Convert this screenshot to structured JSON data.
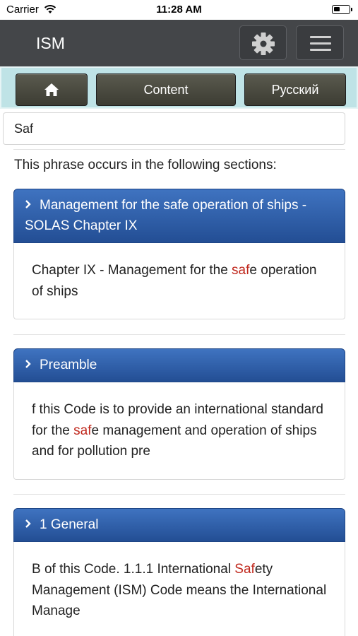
{
  "status_bar": {
    "carrier": "Carrier",
    "time": "11:28 AM",
    "battery_level": 0.4
  },
  "navbar": {
    "title": "ISM",
    "settings_icon": "gear-icon",
    "menu_icon": "hamburger-icon"
  },
  "toolbar": {
    "home_icon": "home-icon",
    "content_label": "Content",
    "language_label": "Русский"
  },
  "search": {
    "value": "Saf",
    "placeholder": ""
  },
  "results_intro": "This phrase occurs in the following sections:",
  "results": [
    {
      "title": "Management for the safe operation of ships - SOLAS Chapter IX",
      "excerpt_before": "Chapter IX - Management for the ",
      "excerpt_match": "saf",
      "excerpt_after": "e operation of ships"
    },
    {
      "title": "Preamble",
      "excerpt_before": "f this Code is to provide an international standard for the ",
      "excerpt_match": "saf",
      "excerpt_after": "e management and operation of ships and for pollution pre"
    },
    {
      "title": "1 General",
      "excerpt_before": "B of this Code. 1.1.1 International ",
      "excerpt_match": "Saf",
      "excerpt_after": "ety Management (ISM) Code means the International Manage"
    }
  ],
  "colors": {
    "navbar": "#444649",
    "toolbar": "#bfe3e6",
    "result_header": "#2f5fa8",
    "highlight": "#c0281d"
  }
}
